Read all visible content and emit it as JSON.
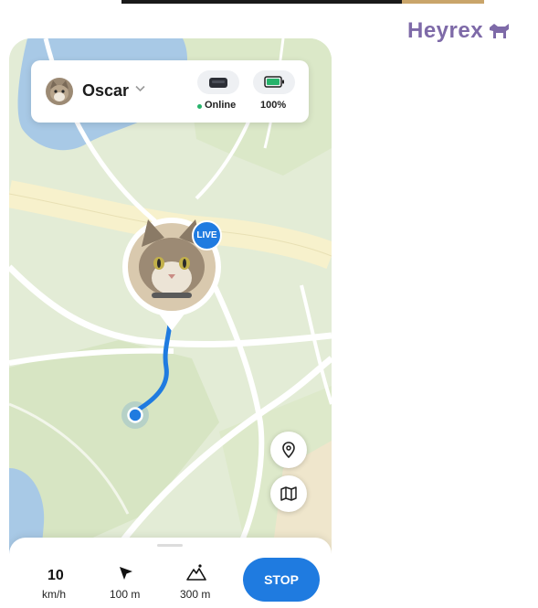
{
  "brand": {
    "name": "Heyrex",
    "color": "#7e6aa8"
  },
  "pet": {
    "name": "Oscar"
  },
  "status": {
    "connection": "Online",
    "battery": "100%"
  },
  "live_badge": "LIVE",
  "stats": {
    "speed_value": "10",
    "speed_unit": "km/h",
    "distance": "100 m",
    "altitude": "300 m"
  },
  "actions": {
    "stop_label": "STOP"
  },
  "icons": [
    "chevron-down-icon",
    "tracker-icon",
    "battery-icon",
    "location-pin-icon",
    "map-icon",
    "navigation-arrow-icon",
    "mountain-icon"
  ],
  "colors": {
    "accent": "#1f7be0",
    "online": "#27b36b",
    "map_green": "#e3ecd6",
    "water": "#a8c9e6"
  }
}
